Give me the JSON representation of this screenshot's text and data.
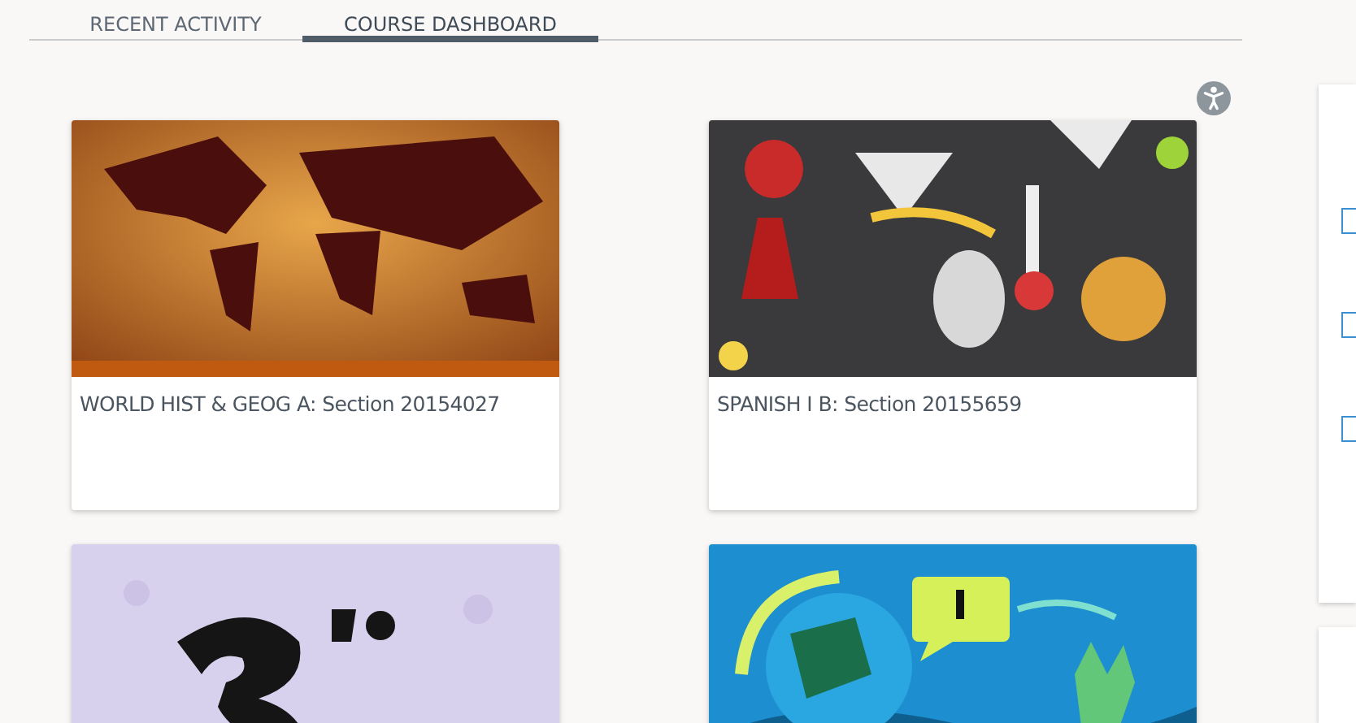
{
  "tabs": [
    {
      "label": "RECENT ACTIVITY",
      "selected": false
    },
    {
      "label": "COURSE DASHBOARD",
      "selected": true
    }
  ],
  "courses": [
    {
      "title": "WORLD HIST & GEOG A: Section 20154027",
      "kind": "picture"
    },
    {
      "title": "SPANISH I B: Section 20155659",
      "kind": "picture"
    },
    {
      "kind": "picture"
    },
    {
      "kind": "picture"
    }
  ]
}
